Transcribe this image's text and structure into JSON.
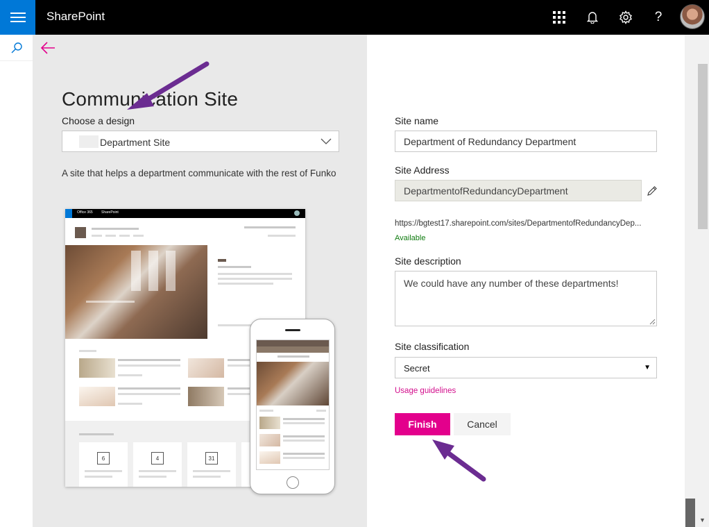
{
  "suitebar": {
    "app_name": "SharePoint",
    "icons": [
      "waffle-menu-icon",
      "app-launcher-icon",
      "bell-icon",
      "gear-icon",
      "help-icon"
    ],
    "help_glyph": "?"
  },
  "panel": {
    "title": "Communication Site",
    "choose_label": "Choose a design",
    "design_value": "Department Site",
    "design_description": "A site that helps a department communicate with the rest of Funko"
  },
  "preview": {
    "topbar_office": "Office 365",
    "topbar_sharepoint": "SharePoint",
    "card_numbers": [
      "6",
      "4",
      "31"
    ]
  },
  "form": {
    "site_name_label": "Site name",
    "site_name_value": "Department of Redundancy Department",
    "site_address_label": "Site Address",
    "site_address_value": "DepartmentofRedundancyDepartment",
    "url": "https://bgtest17.sharepoint.com/sites/DepartmentofRedundancyDep...",
    "availability": "Available",
    "description_label": "Site description",
    "description_value": "We could have any number of these departments!",
    "classification_label": "Site classification",
    "classification_value": "Secret",
    "usage_link": "Usage guidelines",
    "finish_label": "Finish",
    "cancel_label": "Cancel"
  },
  "colors": {
    "accent_blue": "#0078d7",
    "finish_pink": "#e3008c",
    "available_green": "#107c10",
    "annotation_purple": "#6b2c91"
  }
}
